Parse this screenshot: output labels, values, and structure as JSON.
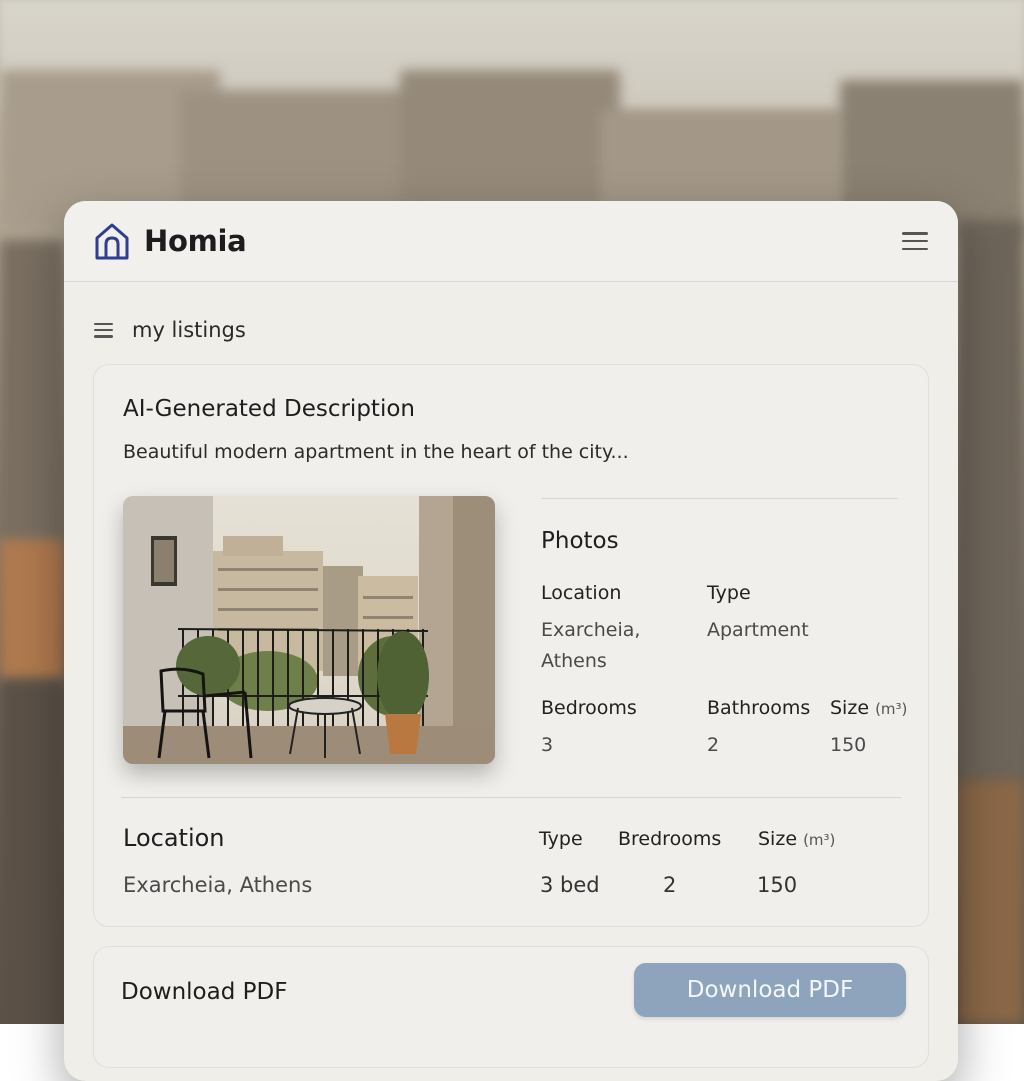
{
  "app": {
    "brand": "Homia",
    "logo_icon": "house-icon",
    "menu_icon": "hamburger-icon"
  },
  "nav": {
    "menu_icon": "hamburger-icon",
    "label": "my listings"
  },
  "description": {
    "title": "AI-Generated Description",
    "text": "Beautiful modern apartment in the heart of the city..."
  },
  "photo": {
    "alt": "balcony-photo"
  },
  "details": {
    "heading": "Photos",
    "location_label": "Location",
    "location_value_line1": "Exarcheia,",
    "location_value_line2": "Athens",
    "type_label": "Type",
    "type_value": "Apartment",
    "bedrooms_label": "Bedrooms",
    "bedrooms_value": "3",
    "bathrooms_label": "Bathrooms",
    "bathrooms_value": "2",
    "size_label": "Size",
    "size_unit": "(m³)",
    "size_value": "150"
  },
  "summary": {
    "location_title": "Location",
    "location_value": "Exarcheia, Athens",
    "type_label": "Type",
    "bedrooms_label": "Bredrooms",
    "size_label": "Size",
    "size_unit": "(m³)",
    "type_value": "3 bed",
    "bedrooms_value": "2",
    "size_value": "150"
  },
  "download": {
    "label": "Download PDF",
    "button_label": "Download PDF"
  },
  "colors": {
    "accent": "#8ea4bd",
    "logo": "#2f3e8f",
    "card": "#efeee9"
  }
}
